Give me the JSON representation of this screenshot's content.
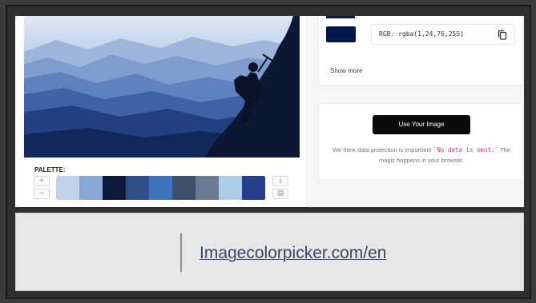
{
  "palette": {
    "label": "PALETTE:",
    "zoom_in_icon": "plus-icon",
    "zoom_out_icon": "minus-icon",
    "download_icon": "download-icon",
    "save_icon": "save-icon",
    "zoom_in": "+",
    "zoom_out": "−",
    "download": "⤓",
    "save": "▤",
    "colors": [
      "#c4d3ea",
      "#89a8d8",
      "#0d1a3a",
      "#2d4f85",
      "#3d73b8",
      "#3e4f6b",
      "#6b7a93",
      "#aecbe8",
      "#24408d"
    ]
  },
  "color_info": {
    "rgb_value": "RGB: rgba(1,24,76,255)",
    "swatch_color": "#00184c",
    "copy_icon": "copy-icon",
    "show_more": "Show more"
  },
  "use_image": {
    "button_label": "Use Your Image",
    "text_before": "We think data protection is important! ",
    "code": "`No data is sent.`",
    "text_after": " The magic happens in your browser."
  },
  "caption": {
    "link_text": "Imagecolorpicker.com/en"
  }
}
